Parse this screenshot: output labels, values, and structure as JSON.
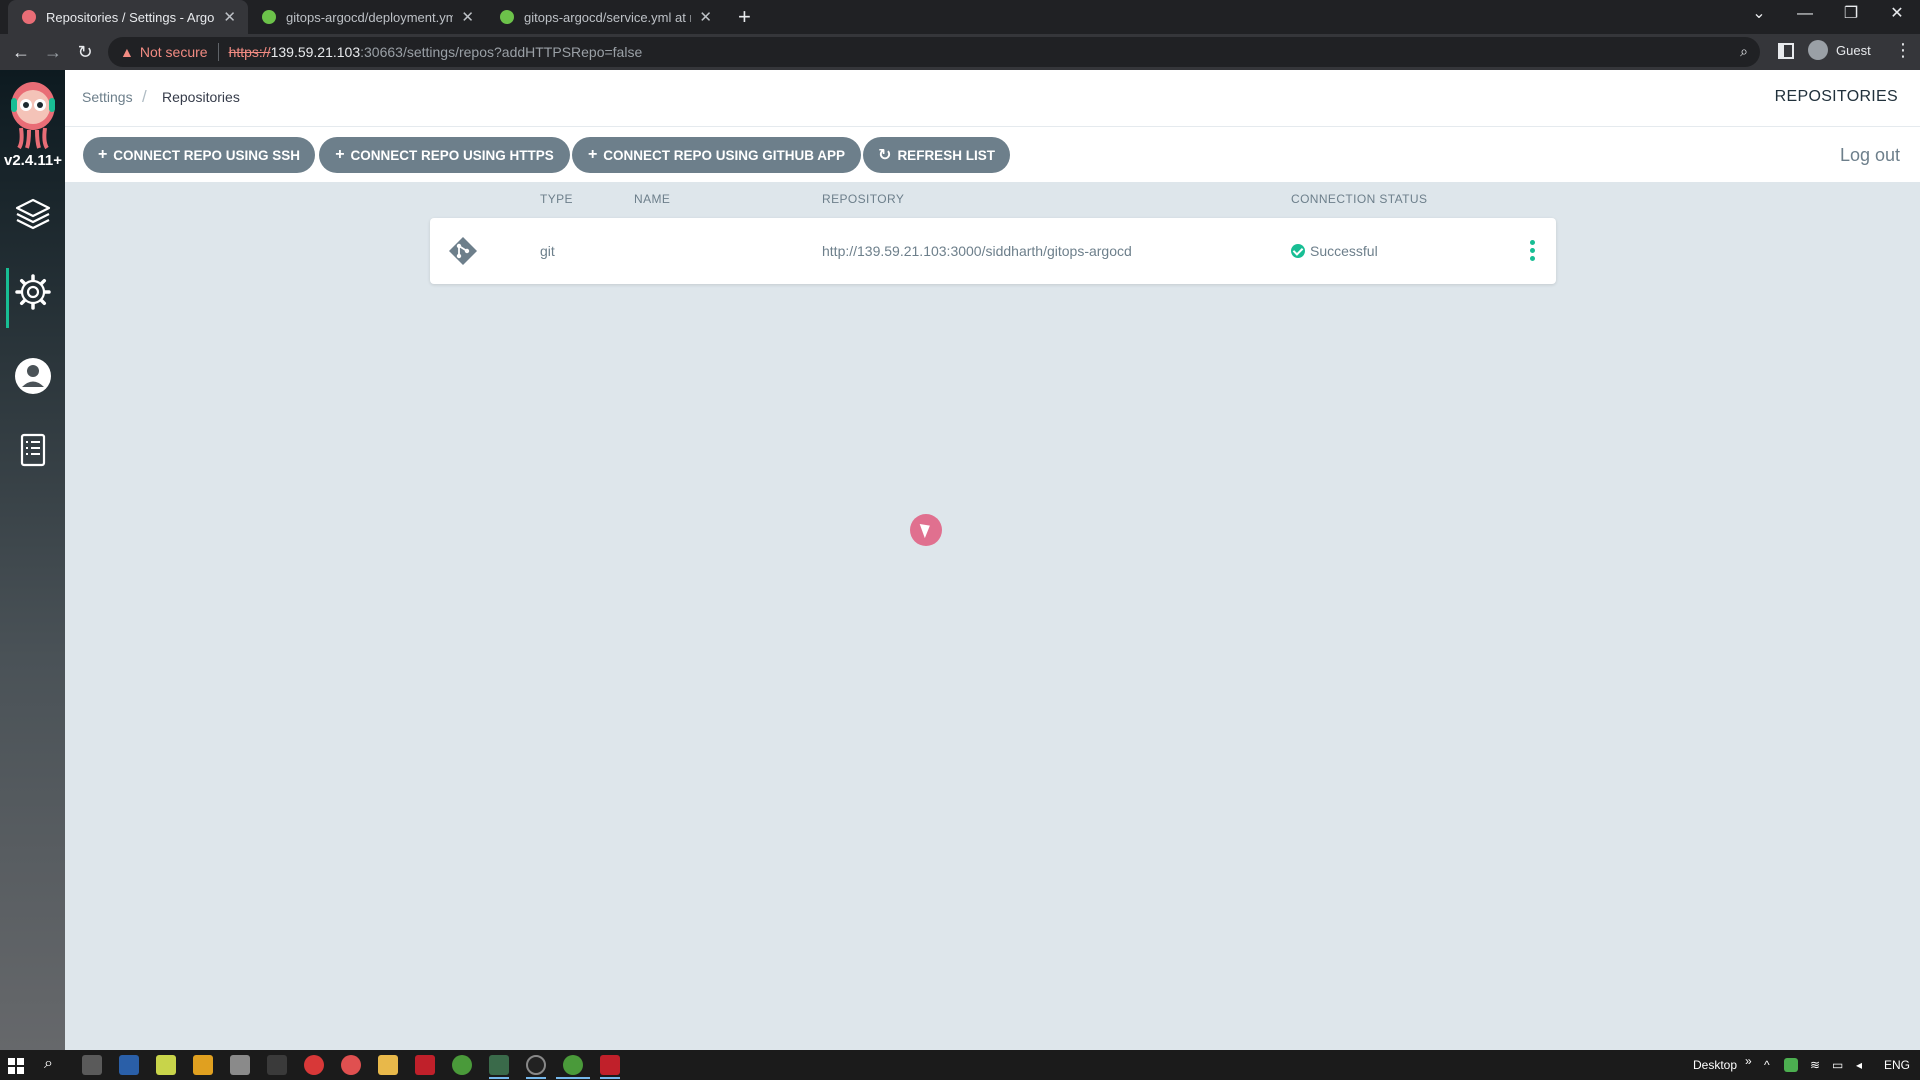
{
  "browser": {
    "tabs": [
      {
        "title": "Repositories / Settings - Argo CD",
        "close": "✕",
        "active": true
      },
      {
        "title": "gitops-argocd/deployment.yml a",
        "close": "✕",
        "active": false
      },
      {
        "title": "gitops-argocd/service.yml at mai",
        "close": "✕",
        "active": false
      }
    ],
    "new_tab": "+",
    "window": {
      "list": "⌄",
      "minimize": "—",
      "restore": "❐",
      "close": "✕"
    },
    "nav": {
      "back": "←",
      "forward": "→",
      "reload": "↻"
    },
    "security_warning": "Not secure",
    "url": {
      "scheme": "https://",
      "host": "139.59.21.103",
      "rest": ":30663/settings/repos?addHTTPSRepo=false"
    },
    "profile": "Guest"
  },
  "sidebar": {
    "version": "v2.4.11+",
    "items": [
      {
        "name": "applications"
      },
      {
        "name": "settings",
        "active": true
      },
      {
        "name": "user-info"
      },
      {
        "name": "documentation"
      }
    ]
  },
  "header": {
    "breadcrumb": {
      "parent": "Settings",
      "separator": "/",
      "current": "Repositories"
    },
    "title": "REPOSITORIES"
  },
  "actions": {
    "connect_ssh": "CONNECT REPO USING SSH",
    "connect_https": "CONNECT REPO USING HTTPS",
    "connect_github_app": "CONNECT REPO USING GITHUB APP",
    "refresh_list": "REFRESH LIST",
    "plus": "+",
    "refresh_glyph": "↻",
    "logout": "Log out"
  },
  "table": {
    "columns": {
      "type": "TYPE",
      "name": "NAME",
      "repository": "REPOSITORY",
      "status": "CONNECTION STATUS"
    },
    "rows": [
      {
        "type": "git",
        "name": "",
        "repository": "http://139.59.21.103:3000/siddharth/gitops-argocd",
        "status": "Successful"
      }
    ]
  },
  "colors": {
    "accent": "#18be94",
    "button": "#6d7f8b",
    "background": "#dee6eb",
    "argo_logo": "#e96d76"
  },
  "taskbar": {
    "tray_label": "Desktop",
    "chevron": "»",
    "lang": "ENG"
  }
}
